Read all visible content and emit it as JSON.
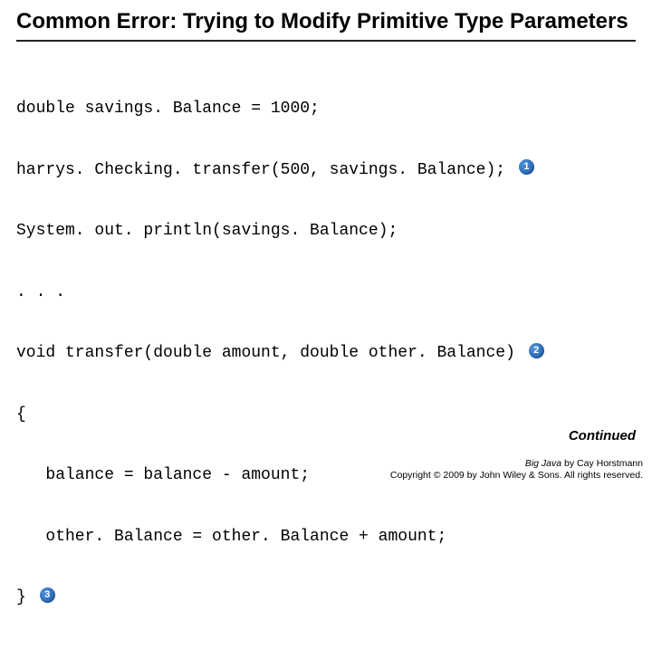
{
  "title": "Common Error: Trying to Modify Primitive Type Parameters",
  "code": {
    "l1": "double savings. Balance = 1000;",
    "l2": "harrys. Checking. transfer(500, savings. Balance);",
    "l3": "System. out. println(savings. Balance);",
    "l4": ". . .",
    "l5": "void transfer(double amount, double other. Balance)",
    "l6": "{",
    "l7": "   balance = balance - amount;",
    "l8": "   other. Balance = other. Balance + amount;",
    "l9": "}"
  },
  "callouts": {
    "c1": "1",
    "c2": "2",
    "c3": "3"
  },
  "continued": "Continued",
  "footer": {
    "book": "Big Java",
    "author": " by Cay Horstmann",
    "copyright": "Copyright © 2009 by John Wiley & Sons. All rights reserved."
  }
}
